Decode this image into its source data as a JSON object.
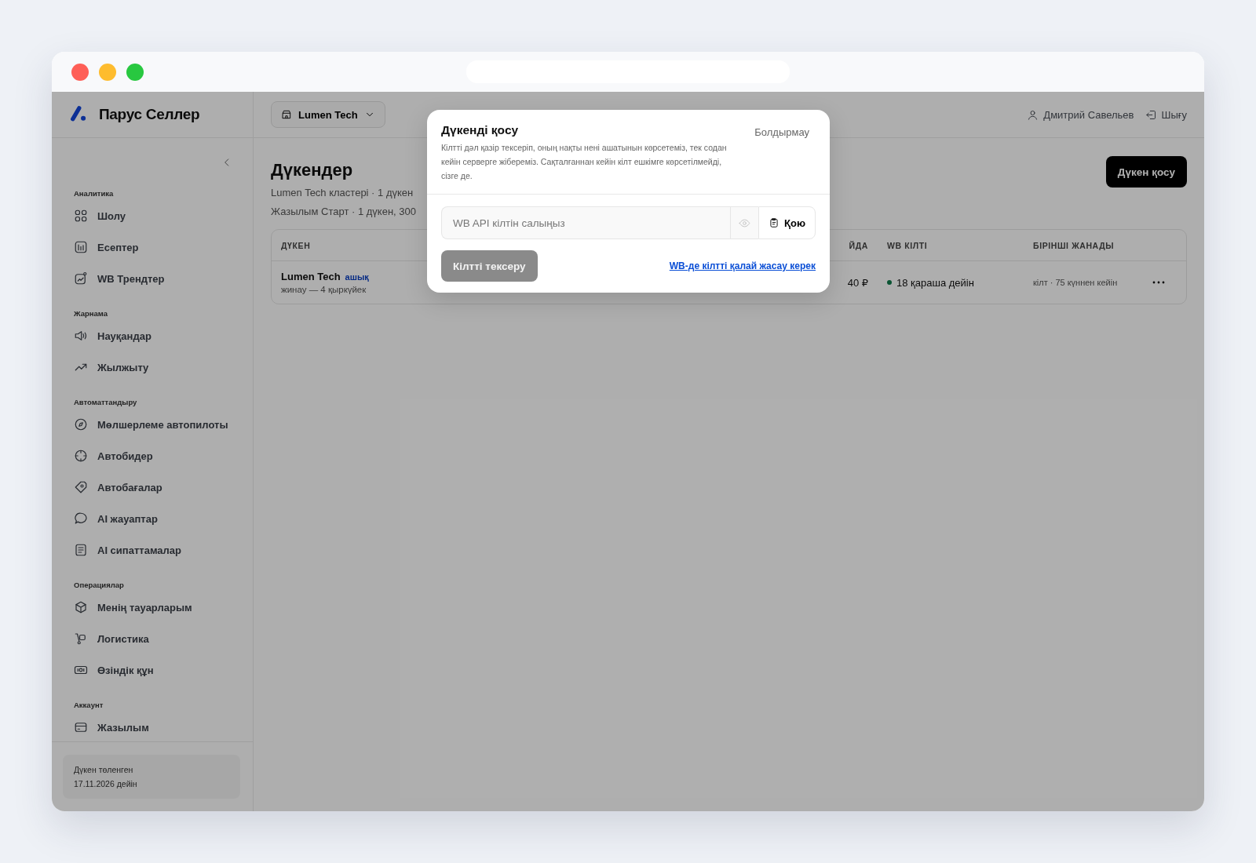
{
  "brand": "Парус Селлер",
  "sidebar": {
    "sections": [
      {
        "title": "Аналитика",
        "items": [
          {
            "label": "Шолу",
            "selected": false
          },
          {
            "label": "Есептер",
            "selected": false
          },
          {
            "label": "WB Трендтер",
            "selected": false
          }
        ]
      },
      {
        "title": "Жарнама",
        "items": [
          {
            "label": "Науқандар",
            "selected": false
          },
          {
            "label": "Жылжыту",
            "selected": false
          }
        ]
      },
      {
        "title": "Автоматтандыру",
        "items": [
          {
            "label": "Мөлшерлеме автопилоты",
            "selected": false
          },
          {
            "label": "Автобидер",
            "selected": false
          },
          {
            "label": "Автобағалар",
            "selected": false
          },
          {
            "label": "AI жауаптар",
            "selected": false
          },
          {
            "label": "AI сипаттамалар",
            "selected": false
          }
        ]
      },
      {
        "title": "Операциялар",
        "items": [
          {
            "label": "Менің тауарларым",
            "selected": false
          },
          {
            "label": "Логистика",
            "selected": false
          },
          {
            "label": "Өзіндік құн",
            "selected": false
          }
        ]
      },
      {
        "title": "Аккаунт",
        "items": [
          {
            "label": "Жазылым",
            "selected": false
          }
        ]
      }
    ],
    "footer": {
      "line_1": "Дүкен төленген",
      "line_2": "17.11.2026 дейін"
    }
  },
  "header": {
    "store_selector": "Lumen Tech",
    "user": "Дмитрий Савельев",
    "logout": "Шығу"
  },
  "page": {
    "title": "Дүкендер",
    "subtitle_lines": [
      "Lumen Tech кластері · 1 дүкен",
      "Жазылым Старт · 1 дүкен, 300"
    ],
    "add_button": "Дүкен қосу"
  },
  "table": {
    "columns": [
      "ДҮКЕН",
      "ЙДА",
      "WB КІЛТІ",
      "БІРІНШІ ЖАНАДЫ"
    ],
    "rows": [
      {
        "store": "Lumen Tech",
        "tag": "ашық",
        "note": "жинау — 4 қыркүйек",
        "column_2": "40 ₽",
        "key_valid": true,
        "wb_key": "18 қараша дейін",
        "first_update": "кілт · 75 күннен кейін"
      }
    ]
  },
  "modal": {
    "title": "Дүкенді қосу",
    "cancel": "Болдырмау",
    "description": "Кілтті дәл қазір тексеріп, оның нақты нені ашатынын көрсетеміз, тек содан кейін серверге жібереміз. Сақталғаннан кейін кілт ешкімге көрсетілмейді, сізге де.",
    "key_field": {
      "placeholder": "WB API кілтін салыңыз"
    },
    "paste_button": "Қою",
    "check_button": {
      "label": "Кілтті тексеру",
      "disabled": true
    },
    "help_link": "WB-де кілтті қалай жасау керек"
  }
}
